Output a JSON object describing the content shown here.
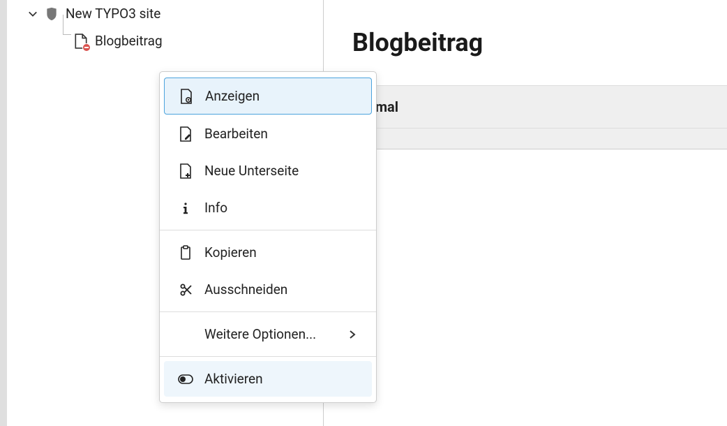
{
  "tree": {
    "root_label": "New TYPO3 site",
    "child_label": "Blogbeitrag"
  },
  "main": {
    "title": "Blogbeitrag",
    "column_normal": "Normal"
  },
  "menu": {
    "view": "Anzeigen",
    "edit": "Bearbeiten",
    "new_subpage": "Neue Unterseite",
    "info": "Info",
    "copy": "Kopieren",
    "cut": "Ausschneiden",
    "more": "Weitere Optionen...",
    "enable": "Aktivieren"
  }
}
